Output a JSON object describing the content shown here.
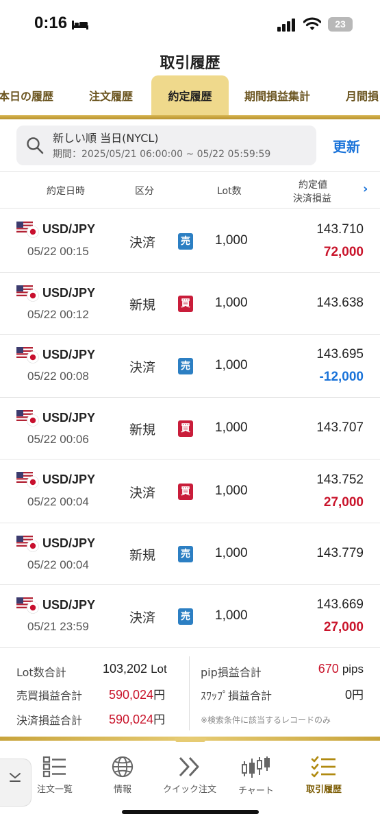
{
  "status_bar": {
    "time": "0:16",
    "battery": "23"
  },
  "page_title": "取引履歴",
  "tabs": [
    {
      "label": "本日の履歴",
      "active": false
    },
    {
      "label": "注文履歴",
      "active": false
    },
    {
      "label": "約定履歴",
      "active": true
    },
    {
      "label": "期間損益集計",
      "active": false
    },
    {
      "label": "月間損",
      "active": false
    }
  ],
  "search": {
    "main": "新しい順 当日(NYCL)",
    "period": "期間：2025/05/21 06:00:00 ~ 05/22 05:59:59",
    "refresh_label": "更新"
  },
  "columns": {
    "date": "約定日時",
    "kind": "区分",
    "lot": "Lot数",
    "price": "約定値",
    "pl": "決済損益"
  },
  "trades": [
    {
      "pair": "USD/JPY",
      "datetime": "05/22 00:15",
      "kind": "決済",
      "side": "売",
      "side_type": "sell",
      "lot": "1,000",
      "price": "143.710",
      "pl": "72,000",
      "pl_sign": "pos"
    },
    {
      "pair": "USD/JPY",
      "datetime": "05/22 00:12",
      "kind": "新規",
      "side": "買",
      "side_type": "buy",
      "lot": "1,000",
      "price": "143.638",
      "pl": "",
      "pl_sign": ""
    },
    {
      "pair": "USD/JPY",
      "datetime": "05/22 00:08",
      "kind": "決済",
      "side": "売",
      "side_type": "sell",
      "lot": "1,000",
      "price": "143.695",
      "pl": "-12,000",
      "pl_sign": "neg"
    },
    {
      "pair": "USD/JPY",
      "datetime": "05/22 00:06",
      "kind": "新規",
      "side": "買",
      "side_type": "buy",
      "lot": "1,000",
      "price": "143.707",
      "pl": "",
      "pl_sign": ""
    },
    {
      "pair": "USD/JPY",
      "datetime": "05/22 00:04",
      "kind": "決済",
      "side": "買",
      "side_type": "buy",
      "lot": "1,000",
      "price": "143.752",
      "pl": "27,000",
      "pl_sign": "pos"
    },
    {
      "pair": "USD/JPY",
      "datetime": "05/22 00:04",
      "kind": "新規",
      "side": "売",
      "side_type": "sell",
      "lot": "1,000",
      "price": "143.779",
      "pl": "",
      "pl_sign": ""
    },
    {
      "pair": "USD/JPY",
      "datetime": "05/21 23:59",
      "kind": "決済",
      "side": "売",
      "side_type": "sell",
      "lot": "1,000",
      "price": "143.669",
      "pl": "27,000",
      "pl_sign": "pos"
    }
  ],
  "summary": {
    "lot_total_label": "Lot数合計",
    "lot_total_value": "103,202",
    "lot_total_unit": "Lot",
    "trade_pl_label": "売買損益合計",
    "trade_pl_value": "590,024",
    "trade_pl_unit": "円",
    "settle_pl_label": "決済損益合計",
    "settle_pl_value": "590,024",
    "settle_pl_unit": "円",
    "pip_pl_label": "pip損益合計",
    "pip_pl_value": "670",
    "pip_pl_unit": "pips",
    "swap_pl_label": "ｽﾜｯﾌﾟ損益合計",
    "swap_pl_value": "0",
    "swap_pl_unit": "円",
    "note": "※検索条件に該当するレコードのみ"
  },
  "bottom_nav": [
    {
      "label": "注文一覧",
      "icon": "list-icon",
      "active": false
    },
    {
      "label": "情報",
      "icon": "globe-icon",
      "active": false
    },
    {
      "label": "クイック注文",
      "icon": "double-chevron-icon",
      "active": false
    },
    {
      "label": "チャート",
      "icon": "candlestick-icon",
      "active": false
    },
    {
      "label": "取引履歴",
      "icon": "checklist-icon",
      "active": true
    }
  ],
  "colors": {
    "accent_gold": "#d7b550",
    "active_tab_bg": "#efd98c",
    "link_blue": "#1a73d9",
    "profit_red": "#c9142b",
    "loss_blue": "#1a73d9",
    "sell_badge": "#2c7fc3",
    "buy_badge": "#c91d3a"
  }
}
